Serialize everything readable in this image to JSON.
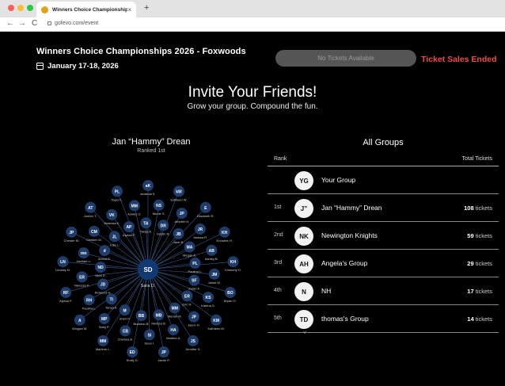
{
  "browser": {
    "tab_title": "Winners Choice Championship",
    "tab_close": "×",
    "new_tab": "+",
    "url": "gofevo.com/event",
    "nav_back": "←",
    "nav_forward": "→",
    "nav_reload": "C"
  },
  "event": {
    "title": "Winners Choice Championships 2026 - Foxwoods",
    "dates": "January 17-18, 2026",
    "no_tickets_label": "No Tickets Available",
    "sales_status": "Ticket Sales Ended"
  },
  "invite": {
    "title": "Invite Your Friends!",
    "subtitle": "Grow your group. Compound the fun."
  },
  "person": {
    "name": "Jan “Hammy” Drean",
    "rank": "Ranked 1st"
  },
  "network": {
    "center": {
      "initials": "SD",
      "name": "Sara D."
    },
    "colors": {
      "node": "#1f3d6b",
      "line": "#3a5a8c",
      "center": "#123a72"
    },
    "nodes": [
      {
        "initials": "aK",
        "name": "amanda K."
      },
      {
        "initials": "NS",
        "name": "Nicole S."
      },
      {
        "initials": "DR",
        "name": "Dustin R."
      },
      {
        "initials": "kW",
        "name": "kathleen W."
      },
      {
        "initials": "JP",
        "name": "Jennifer H."
      },
      {
        "initials": "JB",
        "name": "Jane B."
      },
      {
        "initials": "E",
        "name": "Elizabeth R."
      },
      {
        "initials": "JR",
        "name": "Jessica R."
      },
      {
        "initials": "MA",
        "name": "Megan A."
      },
      {
        "initials": "KH",
        "name": "Knowles H."
      },
      {
        "initials": "AB",
        "name": "Ashley B."
      },
      {
        "initials": "PL",
        "name": "Paulina L."
      },
      {
        "initials": "KH",
        "name": "Kimberly H."
      },
      {
        "initials": "JM",
        "name": "Jaime M."
      },
      {
        "initials": "SF",
        "name": "Sarah F."
      },
      {
        "initials": "BO",
        "name": "Bryan O."
      },
      {
        "initials": "KS",
        "name": "Katrina S."
      },
      {
        "initials": "ER",
        "name": "Eric R."
      },
      {
        "initials": "KM",
        "name": "Kathleen M."
      },
      {
        "initials": "JP",
        "name": "Jason H."
      },
      {
        "initials": "MM",
        "name": "Meriah M."
      },
      {
        "initials": "JS",
        "name": "Jennifer S."
      },
      {
        "initials": "HA",
        "name": "Heather A."
      },
      {
        "initials": "MB",
        "name": "Melissa B."
      },
      {
        "initials": "JP",
        "name": "Jamie P."
      },
      {
        "initials": "SI",
        "name": "Sean I."
      },
      {
        "initials": "BB",
        "name": "Brandon B."
      },
      {
        "initials": "ED",
        "name": "Emily D."
      },
      {
        "initials": "CB",
        "name": "Chelsea B."
      },
      {
        "initials": "M",
        "name": "Sheri P."
      },
      {
        "initials": "MM",
        "name": "Marlene L."
      },
      {
        "initials": "MP",
        "name": "Mary P."
      },
      {
        "initials": "TI",
        "name": "Tanya A."
      },
      {
        "initials": "A",
        "name": "Morgan M."
      },
      {
        "initials": "RH",
        "name": "Paulina L."
      },
      {
        "initials": "JD",
        "name": "Rebecca H."
      },
      {
        "initials": "RF",
        "name": "Alyssa F."
      },
      {
        "initials": "ER",
        "name": "Vanessa K."
      },
      {
        "initials": "ND",
        "name": "Nina D."
      },
      {
        "initials": "LN",
        "name": "Lindsey N."
      },
      {
        "initials": "mn",
        "name": "michael n."
      },
      {
        "initials": "d",
        "name": "donna E."
      },
      {
        "initials": "JP",
        "name": "Chester M."
      },
      {
        "initials": "CM",
        "name": "Chester M."
      },
      {
        "initials": "JL",
        "name": "Julia L."
      },
      {
        "initials": "AT",
        "name": "Amber T."
      },
      {
        "initials": "VK",
        "name": "Vanessa K."
      },
      {
        "initials": "AP",
        "name": "Alyssa F."
      },
      {
        "initials": "PL",
        "name": "Taylor L."
      },
      {
        "initials": "MM",
        "name": "Ashley O."
      },
      {
        "initials": "TA",
        "name": "Tanya A."
      }
    ]
  },
  "groups": {
    "title": "All Groups",
    "col_rank": "Rank",
    "col_total": "Total Tickets",
    "unit": "tickets",
    "rows": [
      {
        "rank": "",
        "initials": "YG",
        "name": "Your Group",
        "count": ""
      },
      {
        "rank": "1st",
        "initials": "J”",
        "name": "Jan “Hammy” Drean",
        "count": "108"
      },
      {
        "rank": "2nd",
        "initials": "NK",
        "name": "Newington Knights",
        "count": "59"
      },
      {
        "rank": "3rd",
        "initials": "AH",
        "name": "Angela's Group",
        "count": "29"
      },
      {
        "rank": "4th",
        "initials": "N",
        "name": "NH",
        "count": "17"
      },
      {
        "rank": "5th",
        "initials": "TD",
        "name": "thomas's Group",
        "count": "14"
      }
    ]
  }
}
